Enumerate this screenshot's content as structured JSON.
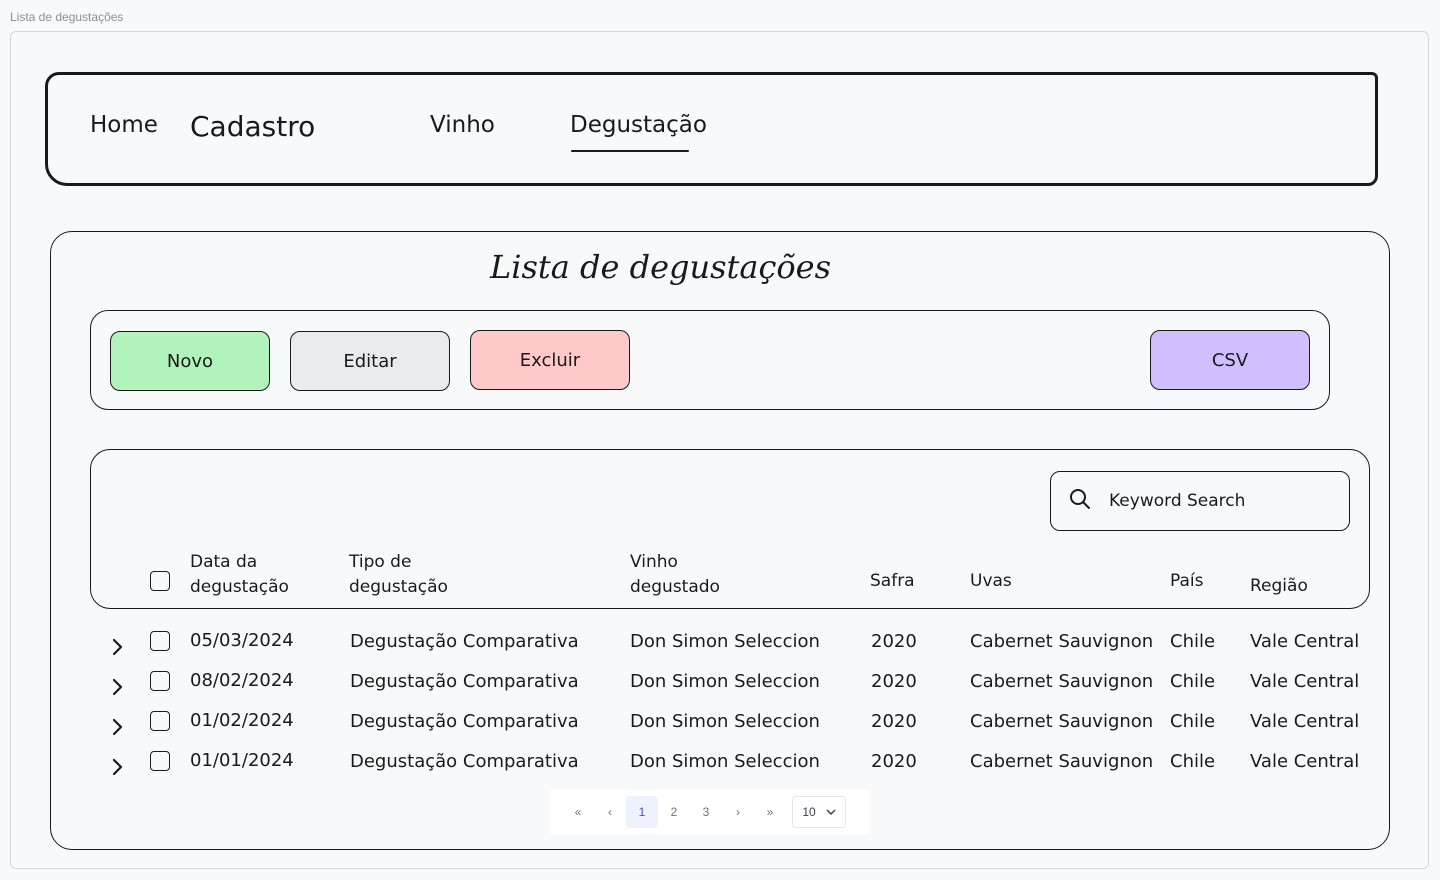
{
  "frame": {
    "title": "Lista de degustações"
  },
  "nav": {
    "home": "Home",
    "cadastro": "Cadastro",
    "vinho": "Vinho",
    "degustacao": "Degustação"
  },
  "page": {
    "title": "Lista de degustações"
  },
  "toolbar": {
    "novo": "Novo",
    "editar": "Editar",
    "excluir": "Excluir",
    "csv": "CSV",
    "colors": {
      "novo": "#b2f2bb",
      "editar": "#e9ecef",
      "excluir": "#ffc9c9",
      "csv": "#d0bfff"
    }
  },
  "search": {
    "placeholder": "Keyword Search"
  },
  "table": {
    "headers": {
      "data_1": "Data da",
      "data_2": "degustação",
      "tipo_1": "Tipo de",
      "tipo_2": "degustação",
      "vinho_1": "Vinho",
      "vinho_2": "degustado",
      "safra": "Safra",
      "uvas": "Uvas",
      "pais": "País",
      "regiao": "Região"
    },
    "rows": [
      {
        "data": "05/03/2024",
        "tipo": "Degustação Comparativa",
        "vinho": "Don Simon Seleccion",
        "safra": "2020",
        "uvas": "Cabernet Sauvignon",
        "pais": "Chile",
        "regiao": "Vale Central"
      },
      {
        "data": "08/02/2024",
        "tipo": "Degustação Comparativa",
        "vinho": "Don Simon Seleccion",
        "safra": "2020",
        "uvas": "Cabernet Sauvignon",
        "pais": "Chile",
        "regiao": "Vale Central"
      },
      {
        "data": "01/02/2024",
        "tipo": "Degustação Comparativa",
        "vinho": "Don Simon Seleccion",
        "safra": "2020",
        "uvas": "Cabernet Sauvignon",
        "pais": "Chile",
        "regiao": "Vale Central"
      },
      {
        "data": "01/01/2024",
        "tipo": "Degustação Comparativa",
        "vinho": "Don Simon Seleccion",
        "safra": "2020",
        "uvas": "Cabernet Sauvignon",
        "pais": "Chile",
        "regiao": "Vale Central"
      }
    ]
  },
  "pagination": {
    "first": "«",
    "prev": "‹",
    "pages": [
      "1",
      "2",
      "3"
    ],
    "current": "1",
    "next": "›",
    "last": "»",
    "page_size": "10"
  }
}
